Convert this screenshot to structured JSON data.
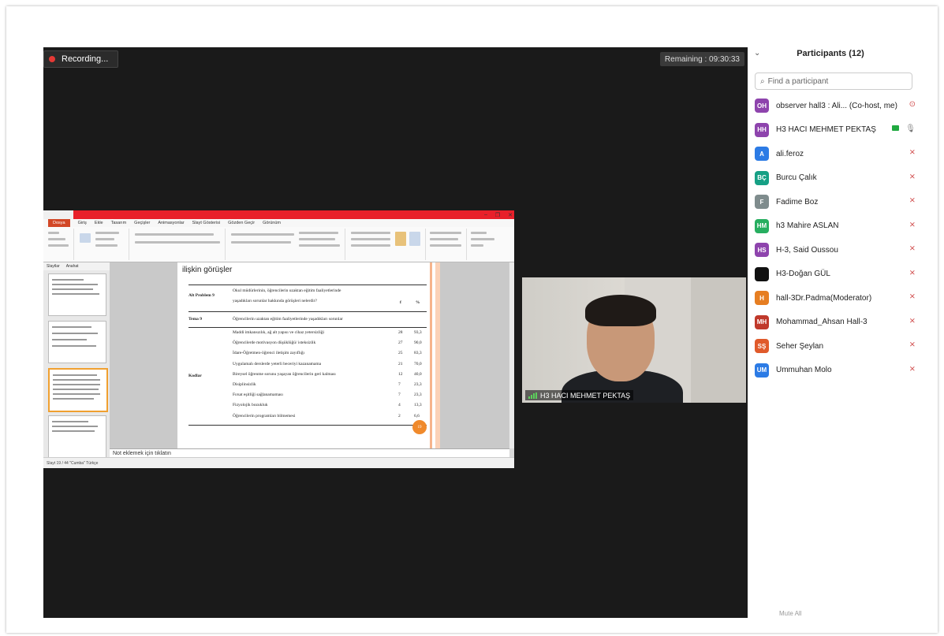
{
  "meeting": {
    "recording_label": "Recording...",
    "remaining_label": "Remaining : 09:30:33"
  },
  "share": {
    "window_title": "...",
    "tabs": [
      "Dosya",
      "Giriş",
      "Ekle",
      "Tasarım",
      "Geçişler",
      "Animasyonlar",
      "Slayt Gösterisi",
      "Gözden Geçir",
      "Görünüm"
    ],
    "left_pane_tabs": [
      "Slaytlar",
      "Anahat"
    ],
    "slide_heading": "ilişkin görüşler",
    "table": {
      "alt_problem_label": "Alt Problem 9",
      "alt_problem_text_1": "Okul müdürlerinin, öğrencilerin uzaktan eğitim faaliyetlerinde",
      "alt_problem_text_2": "yaşadıkları sorunlar hakkında görüşleri nelerdir?",
      "col_f": "f",
      "col_pct": "%",
      "tema_label": "Tema 9",
      "tema_text": "Öğrencilerin uzaktan eğitim faaliyetlerinde yaşadıkları sorunlar",
      "kodlar_label": "Kodlar",
      "rows": [
        {
          "text": "Maddi imkansızlık, ağ alt yapısı ve cihaz yetersizliği",
          "f": "28",
          "pct": "93,3"
        },
        {
          "text": "Öğrencilerde motivasyon düşüklüğü/ isteksizlik",
          "f": "27",
          "pct": "90,0"
        },
        {
          "text": "İdare-Öğretmen-öğrenci iletişim zayıflığı",
          "f": "25",
          "pct": "83,3"
        },
        {
          "text": "Uygulamalı derslerde yeterli beceriyi kazanamama",
          "f": "21",
          "pct": "70,0"
        },
        {
          "text": "Bireysel öğrenme sorunu yaşayan öğrencilerin geri kalması",
          "f": "12",
          "pct": "40,0"
        },
        {
          "text": "Disiplinsizlik",
          "f": "7",
          "pct": "23,3"
        },
        {
          "text": "Fırsat eşitliği sağlanamaması",
          "f": "7",
          "pct": "23,3"
        },
        {
          "text": "Fizyolojik bozukluk",
          "f": "4",
          "pct": "13,3"
        },
        {
          "text": "Öğrencilerin programları bilmemesi",
          "f": "2",
          "pct": "6,6"
        }
      ],
      "badge": "19"
    },
    "notes_placeholder": "Not eklemek için tıklatın",
    "status_text": "Slayt 19 / 44   \"Cumba\"   Türkçe"
  },
  "video": {
    "name_label": "H3 HACI MEHMET PEKTAŞ"
  },
  "participants": {
    "title": "Participants (12)",
    "search_placeholder": "Find a participant",
    "footer": "Mute All",
    "list": [
      {
        "initials": "OH",
        "name": "observer hall3 : Ali... (Co-host, me)",
        "color": "#8e44ad"
      },
      {
        "initials": "HH",
        "name": "H3 HACI MEHMET PEKTAŞ",
        "color": "#8e44ad"
      },
      {
        "initials": "A",
        "name": "ali.feroz",
        "color": "#2c7be5"
      },
      {
        "initials": "BÇ",
        "name": "Burcu Çalık",
        "color": "#16a085"
      },
      {
        "initials": "F",
        "name": "Fadime Boz",
        "color": "#7f8c8d"
      },
      {
        "initials": "HM",
        "name": "h3 Mahire ASLAN",
        "color": "#27ae60"
      },
      {
        "initials": "HS",
        "name": "H-3, Said Oussou",
        "color": "#8e44ad"
      },
      {
        "initials": "",
        "name": "H3-Doğan GÜL",
        "color": "#111111"
      },
      {
        "initials": "H",
        "name": "hall-3Dr.Padma(Moderator)",
        "color": "#e67e22"
      },
      {
        "initials": "MH",
        "name": "Mohammad_Ahsan Hall-3",
        "color": "#c0392b"
      },
      {
        "initials": "SŞ",
        "name": "Seher Şeylan",
        "color": "#e05a2b"
      },
      {
        "initials": "UM",
        "name": "Ummuhan Molo",
        "color": "#2c7be5"
      }
    ]
  }
}
